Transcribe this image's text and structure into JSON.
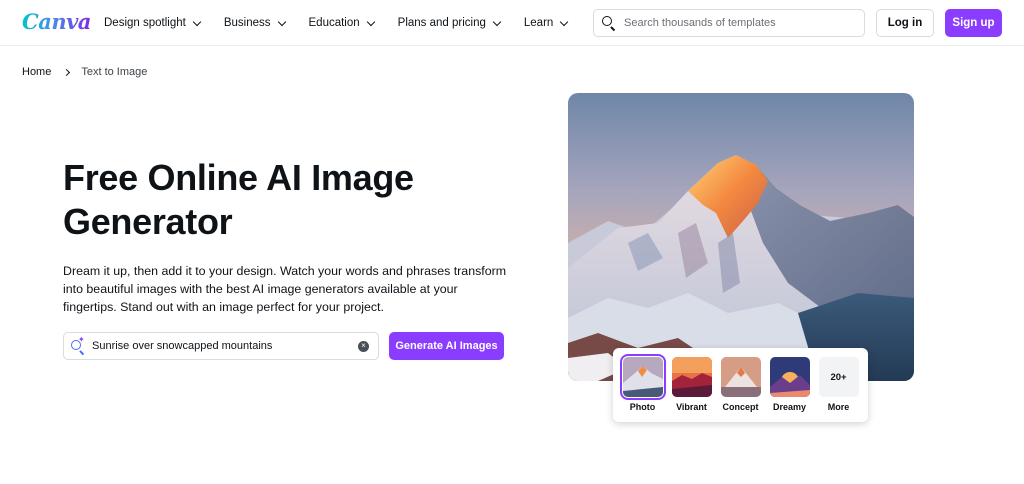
{
  "header": {
    "logo": "Canva",
    "nav": [
      {
        "label": "Design spotlight"
      },
      {
        "label": "Business"
      },
      {
        "label": "Education"
      },
      {
        "label": "Plans and pricing"
      },
      {
        "label": "Learn"
      }
    ],
    "search_placeholder": "Search thousands of templates",
    "login_label": "Log in",
    "signup_label": "Sign up"
  },
  "breadcrumb": {
    "home": "Home",
    "current": "Text to Image"
  },
  "hero": {
    "title": "Free Online AI Image Generator",
    "description": "Dream it up, then add it to your design. Watch your words and phrases transform into beautiful images with the best AI image generators available at your fingertips. Stand out with an image perfect for your project.",
    "prompt_value": "Sunrise over snowcapped mountains",
    "generate_label": "Generate AI Images"
  },
  "styles": [
    {
      "label": "Photo",
      "selected": true,
      "icon": "photo-thumbnail"
    },
    {
      "label": "Vibrant",
      "selected": false,
      "icon": "vibrant-thumbnail"
    },
    {
      "label": "Concept",
      "selected": false,
      "icon": "concept-thumbnail"
    },
    {
      "label": "Dreamy",
      "selected": false,
      "icon": "dreamy-thumbnail"
    },
    {
      "label": "More",
      "selected": false,
      "badge": "20+"
    }
  ],
  "colors": {
    "brand_purple": "#8b3dff",
    "text": "#0e1318",
    "border": "#d8dbdf"
  }
}
